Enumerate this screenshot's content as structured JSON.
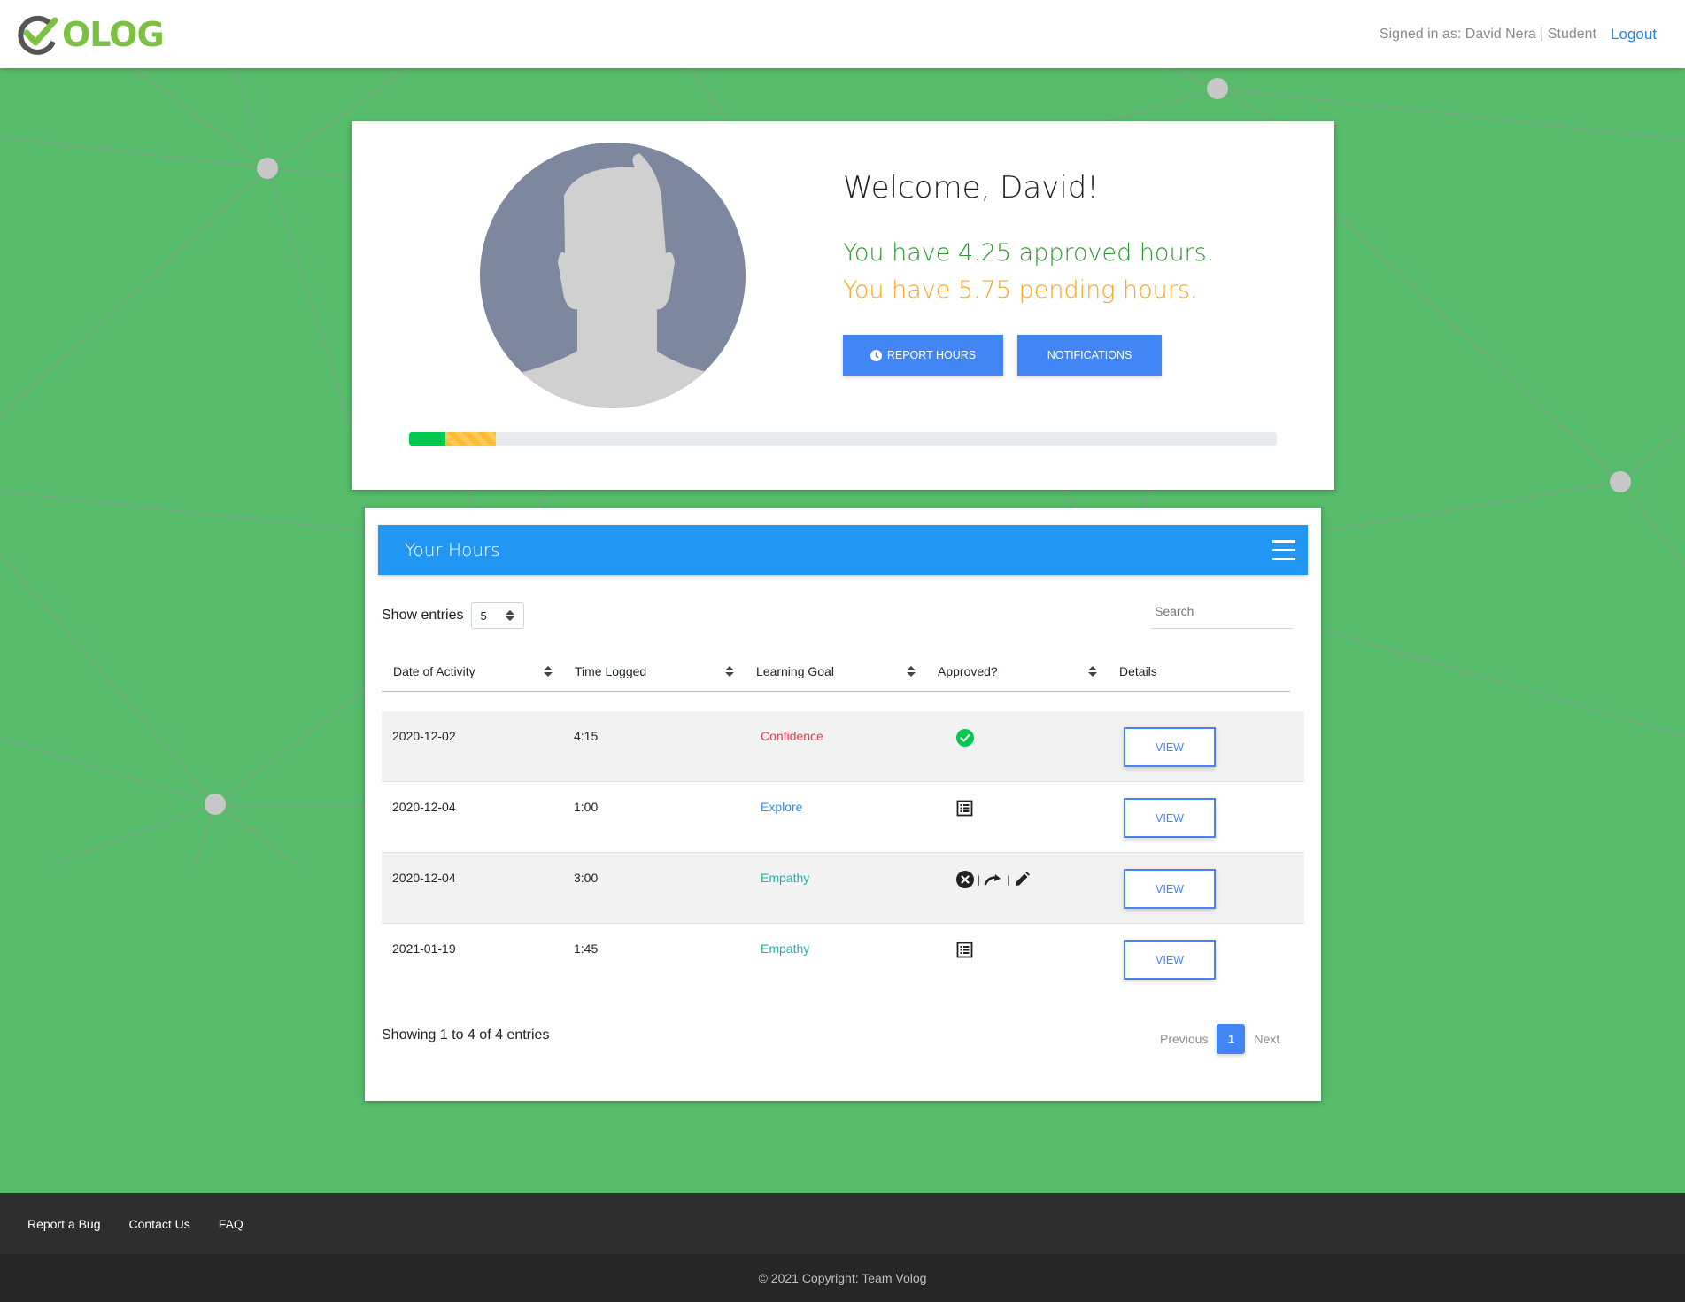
{
  "app": {
    "brand_name": "OLOG",
    "brand_color": "#7cc142"
  },
  "navbar": {
    "signed_in_text": "Signed in as: David Nera | Student",
    "logout_label": "Logout"
  },
  "profile": {
    "welcome": "Welcome, David!",
    "approved_text": "You have 4.25 approved hours.",
    "pending_text": "You have 5.75 pending hours.",
    "approved_hours": 4.25,
    "pending_hours": 5.75,
    "report_hours_label": "REPORT HOURS",
    "notifications_label": "NOTIFICATIONS",
    "progress": {
      "approved_fraction": 0.042,
      "pending_fraction": 0.058
    }
  },
  "hours_table": {
    "title": "Your Hours",
    "show_entries_label": "Show entries",
    "entries_value": "5",
    "search_placeholder": "Search",
    "columns": [
      "Date of Activity",
      "Time Logged",
      "Learning Goal",
      "Approved?",
      "Details"
    ],
    "rows": [
      {
        "date": "2020-12-02",
        "time": "4:15",
        "goal": "Confidence",
        "goal_color": "#e53950",
        "status": "approved",
        "view_label": "VIEW"
      },
      {
        "date": "2020-12-04",
        "time": "1:00",
        "goal": "Explore",
        "goal_color": "#2f8fe8",
        "status": "pending",
        "view_label": "VIEW"
      },
      {
        "date": "2020-12-04",
        "time": "3:00",
        "goal": "Empathy",
        "goal_color": "#21b3a1",
        "status": "rejected",
        "view_label": "VIEW"
      },
      {
        "date": "2021-01-19",
        "time": "1:45",
        "goal": "Empathy",
        "goal_color": "#21b3a1",
        "status": "pending",
        "view_label": "VIEW"
      }
    ],
    "showing_info": "Showing 1 to 4 of 4 entries",
    "pagination": {
      "previous_label": "Previous",
      "current_page": "1",
      "next_label": "Next"
    }
  },
  "footer": {
    "links": [
      "Report a Bug",
      "Contact Us",
      "FAQ"
    ],
    "copyright": "© 2021 Copyright: Team Volog"
  }
}
